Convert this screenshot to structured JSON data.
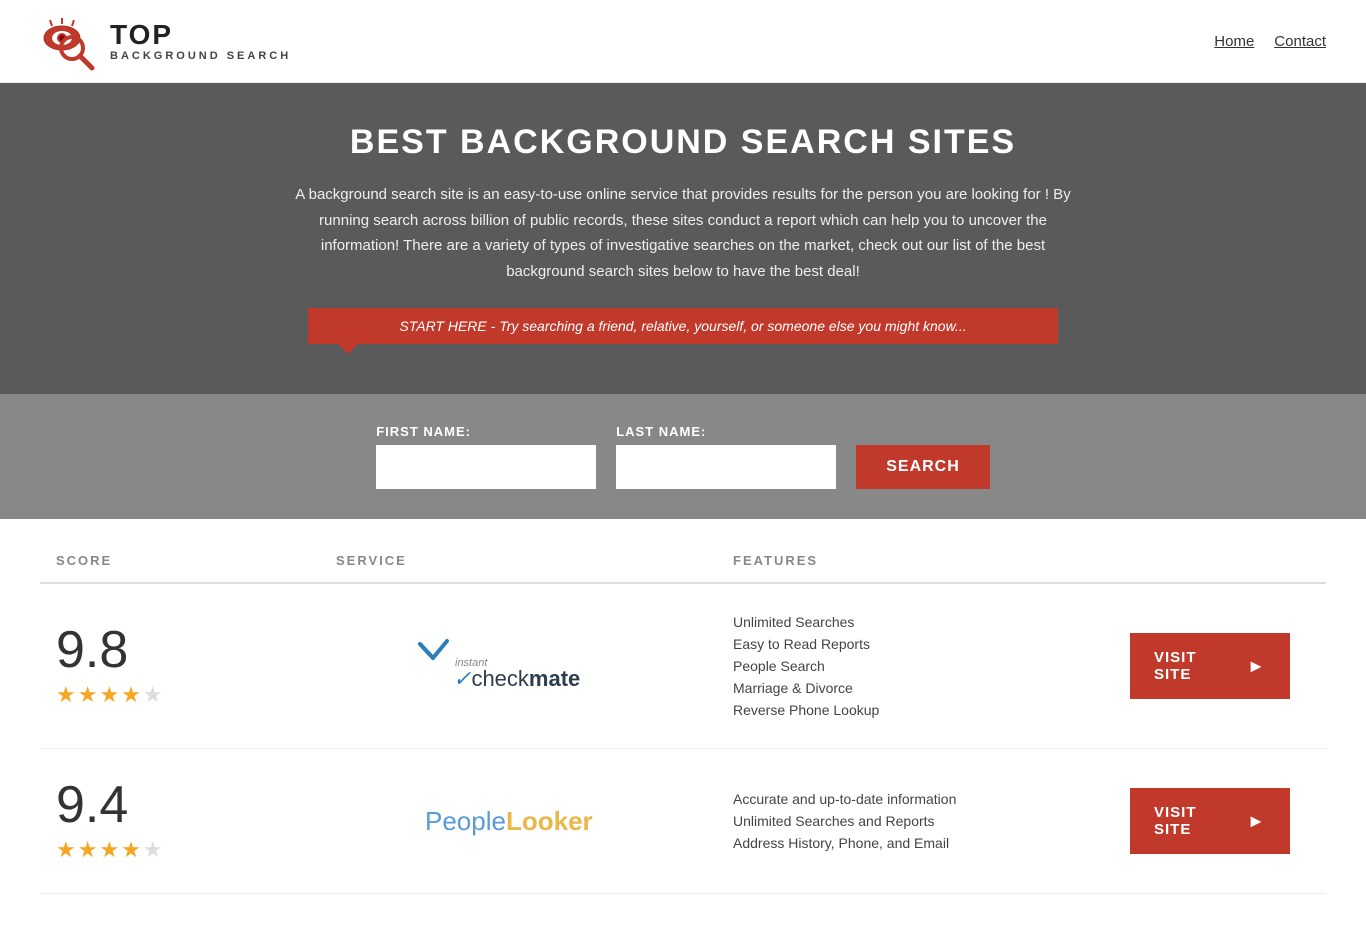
{
  "header": {
    "logo_top": "TOP",
    "logo_bottom": "BACKGROUND SEARCH",
    "nav": [
      {
        "label": "Home",
        "href": "#"
      },
      {
        "label": "Contact",
        "href": "#"
      }
    ]
  },
  "hero": {
    "title": "BEST BACKGROUND SEARCH SITES",
    "description": "A background search site is an easy-to-use online service that provides results  for the person you are looking for ! By  running  search across billion of public records, these sites conduct  a report which can help you to uncover the information! There are a variety of types of investigative searches on the market, check out our  list of the best background search sites below to have the best deal!",
    "search_banner": "START HERE - Try searching a friend, relative, yourself, or someone else you might know..."
  },
  "search_form": {
    "first_name_label": "FIRST NAME:",
    "last_name_label": "LAST NAME:",
    "search_button": "SEARCH",
    "first_name_placeholder": "",
    "last_name_placeholder": ""
  },
  "table": {
    "headers": [
      "SCORE",
      "SERVICE",
      "FEATURES",
      ""
    ],
    "rows": [
      {
        "score": "9.8",
        "stars": "★★★★★",
        "service_name": "Instant Checkmate",
        "features": [
          "Unlimited Searches",
          "Easy to Read Reports",
          "People Search",
          "Marriage & Divorce",
          "Reverse Phone Lookup"
        ],
        "visit_label": "VISIT SITE"
      },
      {
        "score": "9.4",
        "stars": "★★★★★",
        "service_name": "PeopleLooker",
        "features": [
          "Accurate and up-to-date information",
          "Unlimited Searches and Reports",
          "Address History, Phone, and Email"
        ],
        "visit_label": "VISIT SITE"
      }
    ]
  }
}
